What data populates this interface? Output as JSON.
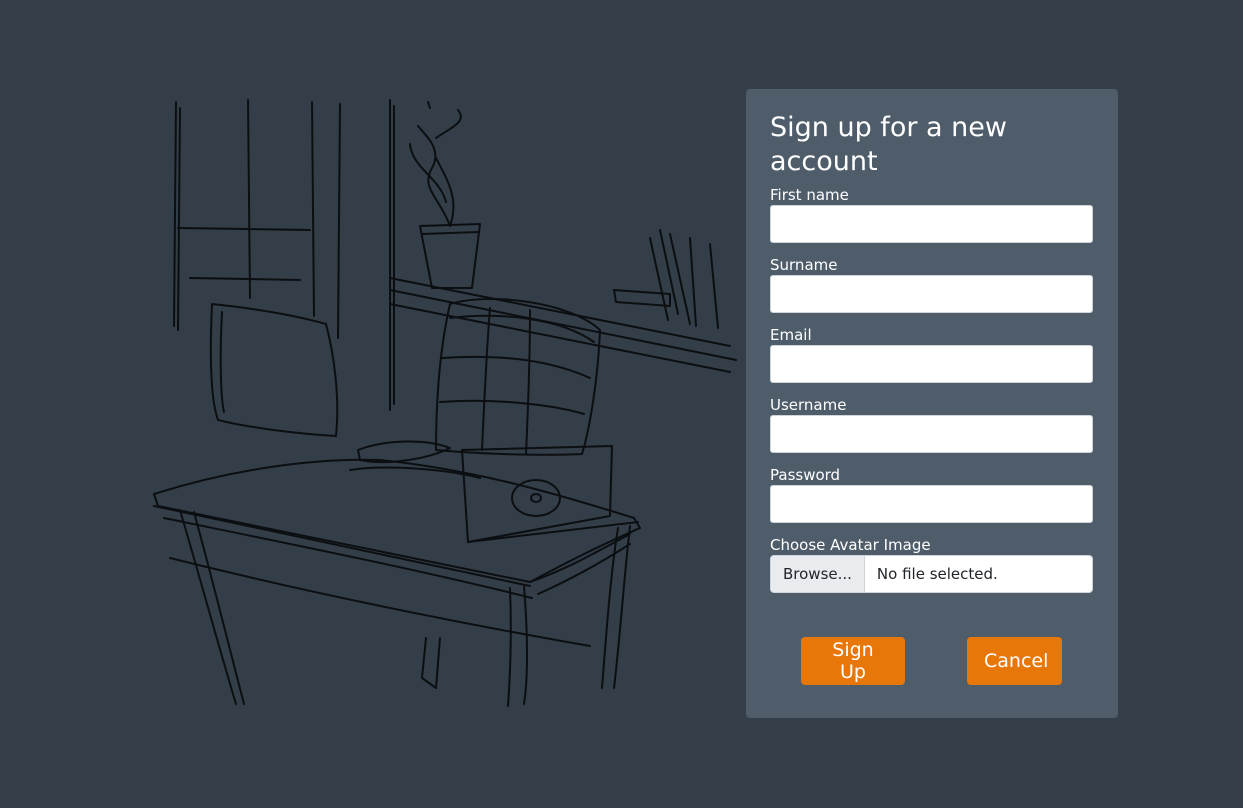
{
  "form": {
    "title": "Sign up for a new account",
    "fields": [
      {
        "label": "First name",
        "value": ""
      },
      {
        "label": "Surname",
        "value": ""
      },
      {
        "label": "Email",
        "value": ""
      },
      {
        "label": "Username",
        "value": ""
      },
      {
        "label": "Password",
        "value": ""
      }
    ],
    "avatar": {
      "label": "Choose Avatar Image",
      "browse_label": "Browse...",
      "status": "No file selected."
    },
    "buttons": {
      "signup_label": "Sign Up",
      "cancel_label": "Cancel"
    }
  },
  "colors": {
    "background": "#343e48",
    "panel": "#4f5d6b",
    "accent": "#e8770a"
  },
  "illustration": {
    "icon": "desk-chair-laptop-sketch"
  }
}
